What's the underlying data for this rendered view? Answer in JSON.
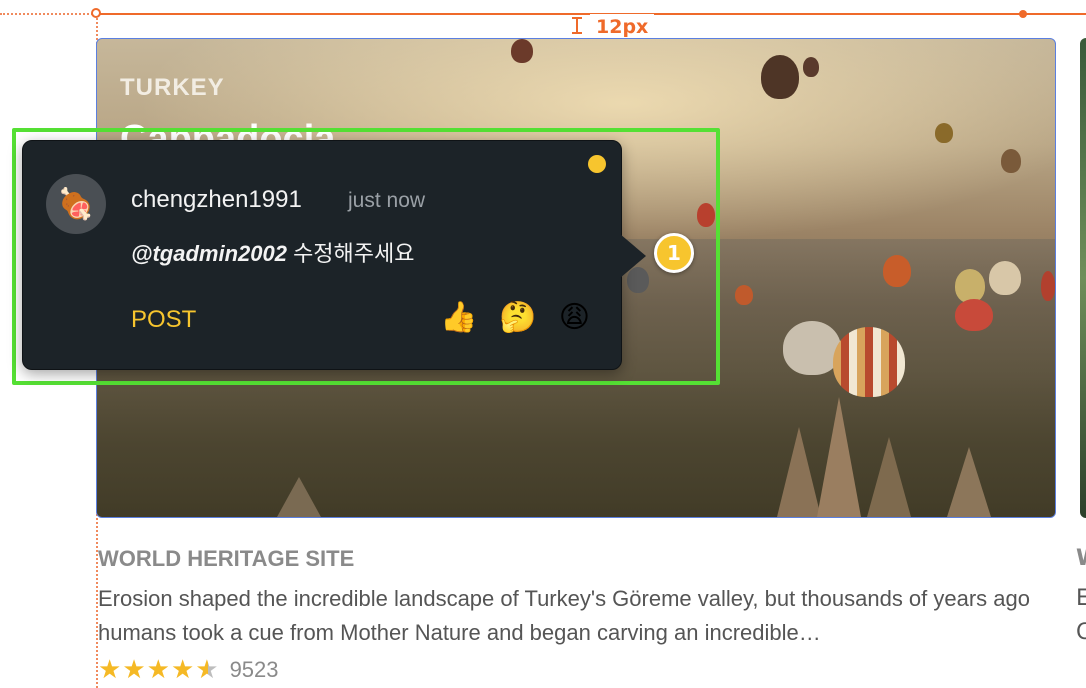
{
  "measure": {
    "label": "12px"
  },
  "card": {
    "country": "TURKEY",
    "title": "Cappadocia",
    "category": "WORLD HERITAGE SITE",
    "description": "Erosion shaped the incredible landscape of Turkey's Göreme valley, but thousands of years ago humans took a cue from Mother Nature and began carving an incredible…",
    "rating_value": 4.5,
    "rating_max": 5,
    "rating_count": "9523"
  },
  "next_card": {
    "category_partial": "W",
    "desc_line1": "E",
    "desc_line2": "C"
  },
  "comment": {
    "username": "chengzhen1991",
    "timestamp": "just now",
    "mention": "@tgadmin2002",
    "message": " 수정해주세요",
    "post_label": "POST",
    "avatar_emoji": "🍖",
    "reactions": [
      "👍",
      "🤔",
      "😩"
    ],
    "status_color": "#f7c52e"
  },
  "pin": {
    "number": "1"
  },
  "colors": {
    "accent": "#f7c52e",
    "highlight": "#55e034",
    "guide": "#ef6a2a",
    "selection": "#5b7fe0"
  }
}
